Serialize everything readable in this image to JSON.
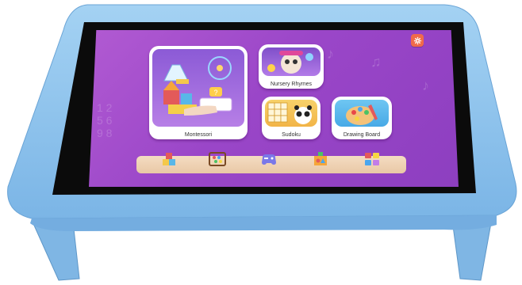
{
  "apps": [
    {
      "label": "Montessori",
      "icon": "montessori-icon"
    },
    {
      "label": "Nursery Rhymes",
      "icon": "nursery-rhymes-icon"
    },
    {
      "label": "Sudoku",
      "icon": "sudoku-icon"
    },
    {
      "label": "Drawing Board",
      "icon": "drawing-board-icon"
    }
  ],
  "dock": [
    {
      "icon": "blocks-icon"
    },
    {
      "icon": "abacus-icon"
    },
    {
      "icon": "gamepad-icon"
    },
    {
      "icon": "shape-sorter-icon"
    },
    {
      "icon": "color-blocks-icon"
    }
  ],
  "settings": {
    "icon": "gear-icon"
  },
  "colors": {
    "table": "#8ec3ec",
    "bezel": "#0b0b0b",
    "screen": "#9a46c8",
    "dock": "#f1d6ba"
  }
}
